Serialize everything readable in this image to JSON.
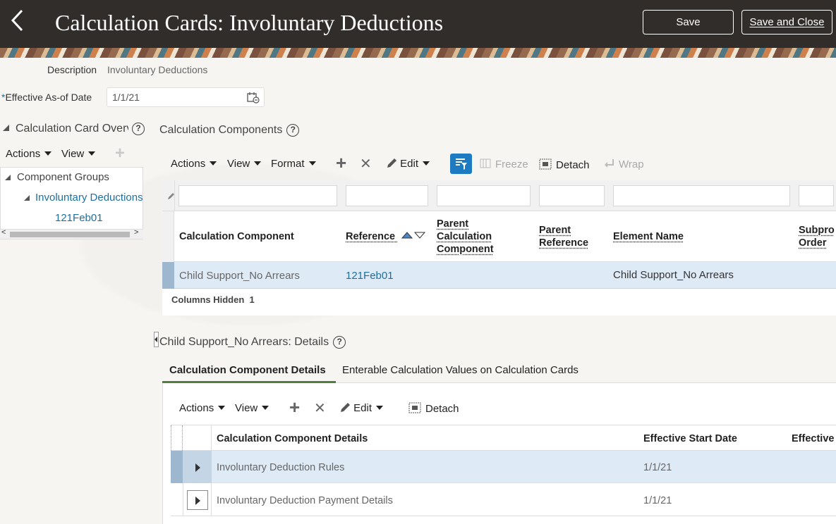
{
  "header": {
    "back_label": "<",
    "title": "Calculation Cards: Involuntary Deductions",
    "save_label": "Save",
    "save_close_label": "Save and Close"
  },
  "form": {
    "description_label": "Description",
    "description_value": "Involuntary Deductions",
    "required_marker": "*",
    "date_label": "Effective As-of Date",
    "date_value": "1/1/21"
  },
  "overview": {
    "title": "Calculation Card Overv",
    "help": "?",
    "toolbar": {
      "actions": "Actions",
      "view": "View",
      "add": "+"
    },
    "tree": {
      "root": "Component Groups",
      "group": "Involuntary Deductions",
      "leaf": "121Feb01"
    },
    "scroll": {
      "left": "<",
      "right": ">"
    }
  },
  "components": {
    "title": "Calculation Components",
    "help": "?",
    "toolbar": {
      "actions": "Actions",
      "view": "View",
      "format": "Format",
      "add": "+",
      "remove": "✕",
      "edit": "Edit",
      "freeze": "Freeze",
      "detach": "Detach",
      "wrap": "Wrap"
    },
    "columns": {
      "calc_component": "Calculation Component",
      "reference": "Reference",
      "parent_calc_component": "Parent Calculation Component",
      "parent_reference": "Parent Reference",
      "element_name": "Element Name",
      "subprocess_order": "Subpro Order"
    },
    "rows": [
      {
        "calc_component": "Child Support_No Arrears",
        "reference": "121Feb01",
        "parent_calc_component": "",
        "parent_reference": "",
        "element_name": "Child Support_No Arrears"
      }
    ],
    "columns_hidden_label": "Columns Hidden",
    "columns_hidden_count": "1"
  },
  "details": {
    "title": "Child Support_No Arrears: Details",
    "help": "?",
    "tabs": [
      {
        "label": "Calculation Component Details",
        "active": true
      },
      {
        "label": "Enterable Calculation Values on Calculation Cards",
        "active": false
      }
    ],
    "toolbar": {
      "actions": "Actions",
      "view": "View",
      "add": "+",
      "remove": "✕",
      "edit": "Edit",
      "detach": "Detach"
    },
    "columns": {
      "details": "Calculation Component Details",
      "start": "Effective Start Date",
      "end": "Effective"
    },
    "rows": [
      {
        "name": "Involuntary Deduction Rules",
        "start": "1/1/21"
      },
      {
        "name": "Involuntary Deduction Payment Details",
        "start": "1/1/21"
      }
    ]
  },
  "colors": {
    "header_bg": "#312d2a",
    "link": "#1e6f9f",
    "selected_row": "#deebf7",
    "accent": "#1e7ac1"
  }
}
